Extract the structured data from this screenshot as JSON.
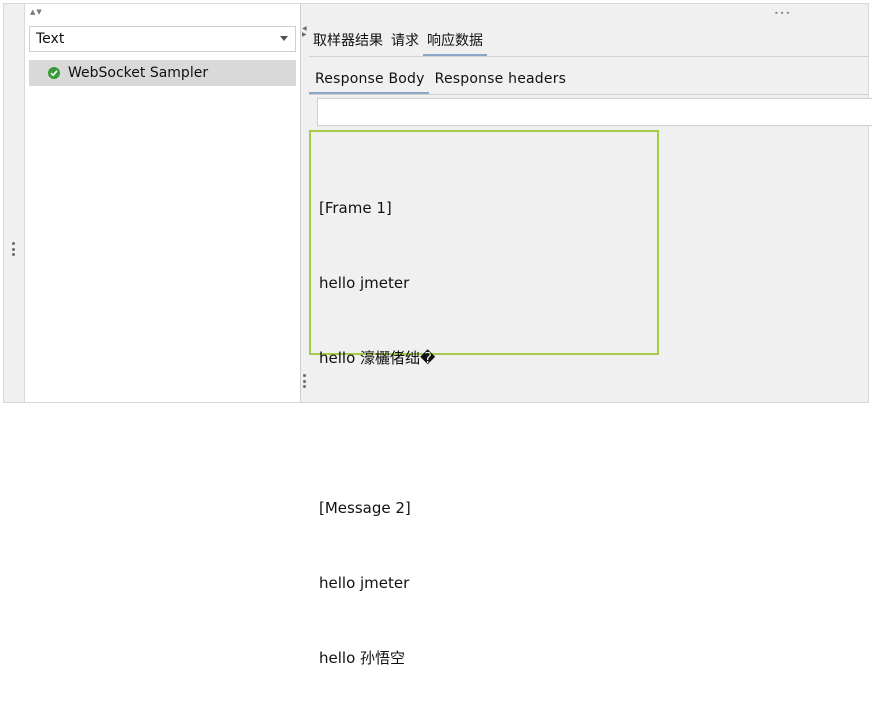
{
  "left_panel": {
    "collapse_arrows": "▲▼",
    "renderer_select": {
      "value": "Text"
    },
    "tree": {
      "items": [
        {
          "label": "WebSocket Sampler",
          "status": "success",
          "icon": "check-shield-icon"
        }
      ]
    }
  },
  "right_panel": {
    "top_dots": "•••",
    "tabs": [
      {
        "label": "取样器结果"
      },
      {
        "label": "请求"
      },
      {
        "label": "响应数据",
        "active": true
      }
    ],
    "subtabs": [
      {
        "label": "Response Body",
        "active": true
      },
      {
        "label": "Response headers"
      }
    ],
    "search": {
      "value": ""
    },
    "response_lines": [
      "[Frame 1]",
      "hello jmeter",
      "hello 濠欐偖绌�",
      "",
      "[Message 2]",
      "hello jmeter",
      "hello 孙悟空"
    ]
  },
  "colors": {
    "highlight_border": "#a6ca4a",
    "selected_row": "#d9d9d9",
    "tab_underline": "#8aa7c7",
    "status_ok": "#3a9a3a"
  }
}
